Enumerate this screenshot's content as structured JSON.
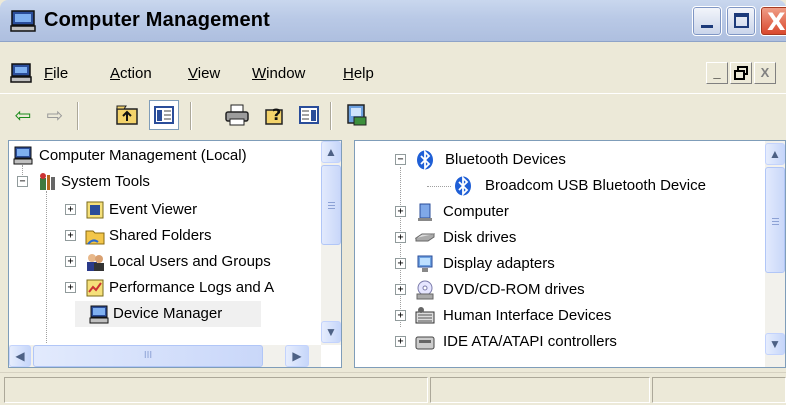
{
  "window": {
    "title": "Computer Management",
    "controls": {
      "minimize": "_",
      "maximize": "□",
      "close": "X"
    }
  },
  "menubar": {
    "items": [
      {
        "label": "File",
        "mnemonic": "F",
        "rest": "ile"
      },
      {
        "label": "Action",
        "mnemonic": "A",
        "rest": "ction"
      },
      {
        "label": "View",
        "mnemonic": "V",
        "rest": "iew"
      },
      {
        "label": "Window",
        "mnemonic": "W",
        "rest": "indow"
      },
      {
        "label": "Help",
        "mnemonic": "H",
        "rest": "elp"
      }
    ],
    "mdi": {
      "minimize": "_",
      "restore": "🗗",
      "close": "X"
    }
  },
  "toolbar": {
    "buttons": [
      {
        "icon": "back-arrow-icon",
        "glyph": "⇦"
      },
      {
        "icon": "forward-arrow-icon",
        "glyph": "⇨"
      },
      {
        "icon": "up-folder-icon",
        "glyph": "▣"
      },
      {
        "icon": "show-hide-tree-icon",
        "glyph": "▥"
      },
      {
        "icon": "print-icon",
        "glyph": "⎙"
      },
      {
        "icon": "help-icon",
        "glyph": "?"
      },
      {
        "icon": "action-pane-icon",
        "glyph": "▤"
      },
      {
        "icon": "properties-icon",
        "glyph": "▦"
      }
    ]
  },
  "tree": {
    "root": "Computer Management (Local)",
    "system_tools": "System Tools",
    "items": [
      "Event Viewer",
      "Shared Folders",
      "Local Users and Groups",
      "Performance Logs and A",
      "Device Manager"
    ],
    "selected": "Device Manager"
  },
  "devices": {
    "bluetooth": "Bluetooth Devices",
    "bluetooth_child": "Broadcom USB Bluetooth Device",
    "categories": [
      "Computer",
      "Disk drives",
      "Display adapters",
      "DVD/CD-ROM drives",
      "Human Interface Devices",
      "IDE ATA/ATAPI controllers"
    ]
  },
  "scrollbar": {
    "grip": "III"
  },
  "colors": {
    "selection": "#f0f0f0",
    "bluetooth": "#1f5fd6",
    "close_button": "#d8452a"
  }
}
